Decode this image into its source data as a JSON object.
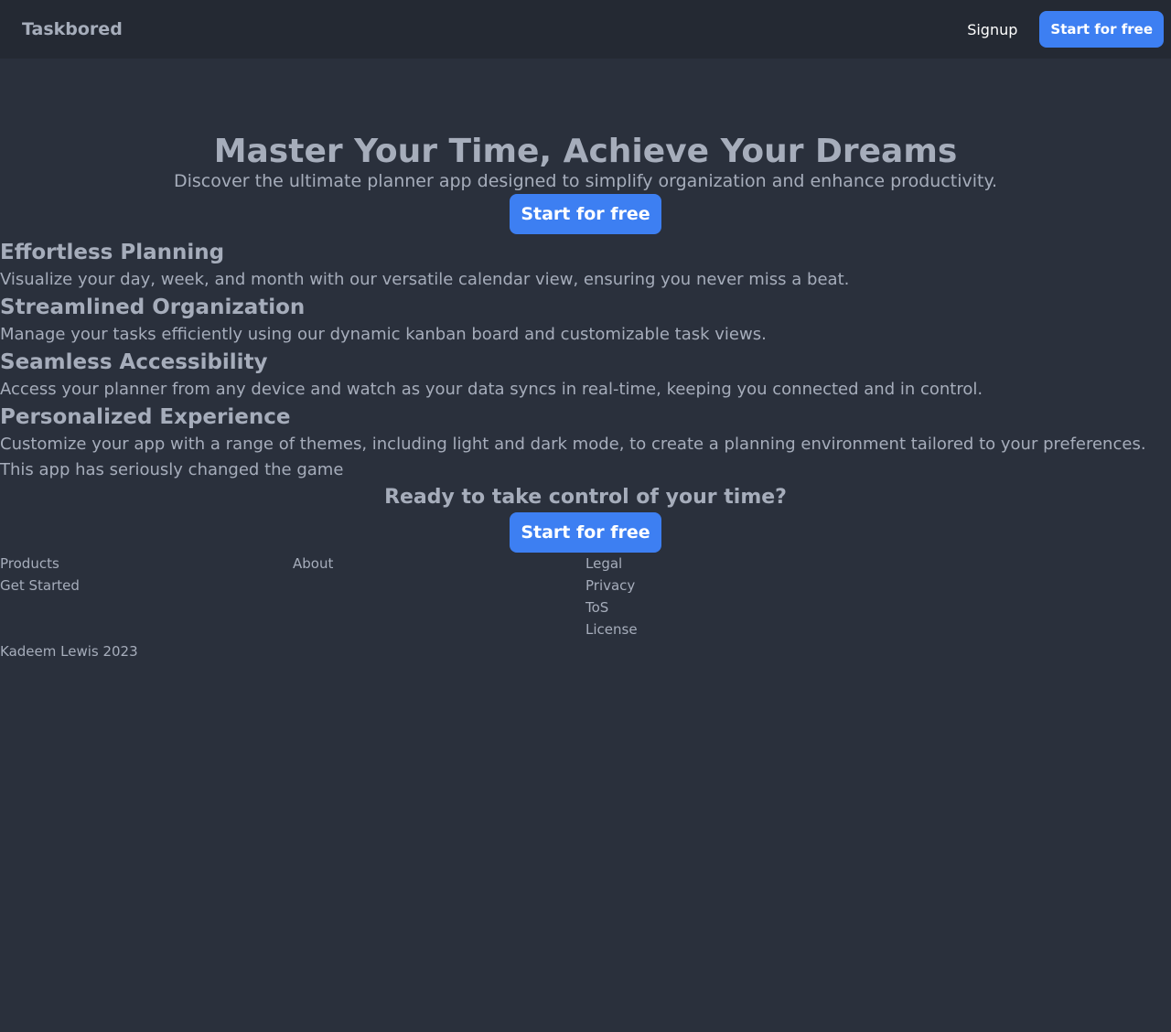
{
  "navbar": {
    "brand": "Taskbored",
    "signup": "Signup",
    "cta": "Start for free"
  },
  "hero": {
    "title": "Master Your Time, Achieve Your Dreams",
    "subtitle": "Discover the ultimate planner app designed to simplify organization and enhance productivity.",
    "cta": "Start for free"
  },
  "features": [
    {
      "title": "Effortless Planning",
      "description": "Visualize your day, week, and month with our versatile calendar view, ensuring you never miss a beat."
    },
    {
      "title": "Streamlined Organization",
      "description": "Manage your tasks efficiently using our dynamic kanban board and customizable task views."
    },
    {
      "title": "Seamless Accessibility",
      "description": "Access your planner from any device and watch as your data syncs in real-time, keeping you connected and in control."
    },
    {
      "title": "Personalized Experience",
      "description": "Customize your app with a range of themes, including light and dark mode, to create a planning environment tailored to your preferences."
    }
  ],
  "testimonial": "This app has seriously changed the game",
  "cta": {
    "title": "Ready to take control of your time?",
    "button": "Start for free"
  },
  "footer": {
    "products": {
      "heading": "Products",
      "links": [
        "Get Started"
      ]
    },
    "about": {
      "heading": "About"
    },
    "legal": {
      "heading": "Legal",
      "links": [
        "Privacy",
        "ToS",
        "License"
      ]
    },
    "copyright": "Kadeem Lewis 2023"
  }
}
